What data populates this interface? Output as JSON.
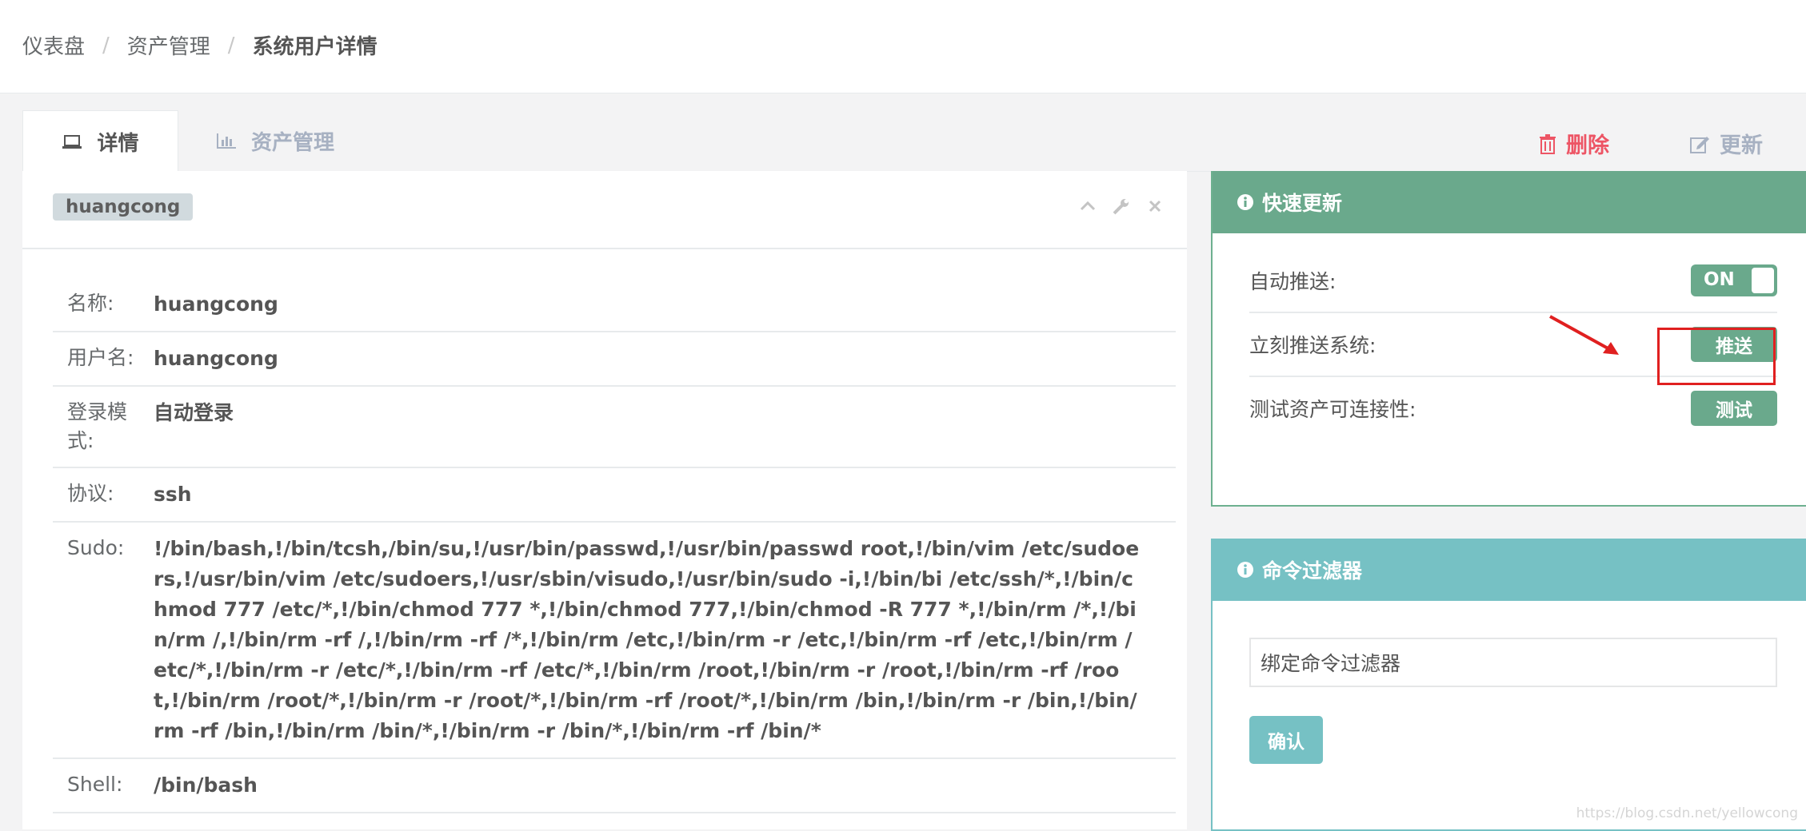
{
  "breadcrumb": [
    "仪表盘",
    "资产管理",
    "系统用户详情"
  ],
  "tabs": {
    "detail": "详情",
    "asset_management": "资产管理"
  },
  "actions": {
    "delete": "删除",
    "update": "更新"
  },
  "detail_panel": {
    "tag": "huangcong",
    "rows": [
      {
        "key": "名称:",
        "value": "huangcong"
      },
      {
        "key": "用户名:",
        "value": "huangcong"
      },
      {
        "key": "登录模式:",
        "value": "自动登录"
      },
      {
        "key": "协议:",
        "value": "ssh"
      },
      {
        "key": "Sudo:",
        "value": "!/bin/bash,!/bin/tcsh,/bin/su,!/usr/bin/passwd,!/usr/bin/passwd root,!/bin/vim /etc/sudoers,!/usr/bin/vim /etc/sudoers,!/usr/sbin/visudo,!/usr/bin/sudo -i,!/bin/bi /etc/ssh/*,!/bin/chmod 777 /etc/*,!/bin/chmod 777 *,!/bin/chmod 777,!/bin/chmod -R 777 *,!/bin/rm /*,!/bin/rm /,!/bin/rm -rf /,!/bin/rm -rf /*,!/bin/rm /etc,!/bin/rm -r /etc,!/bin/rm -rf /etc,!/bin/rm /etc/*,!/bin/rm -r /etc/*,!/bin/rm -rf /etc/*,!/bin/rm /root,!/bin/rm -r /root,!/bin/rm -rf /root,!/bin/rm /root/*,!/bin/rm -r /root/*,!/bin/rm -rf /root/*,!/bin/rm /bin,!/bin/rm -r /bin,!/bin/rm -rf /bin,!/bin/rm /bin/*,!/bin/rm -r /bin/*,!/bin/rm -rf /bin/*"
      },
      {
        "key": "Shell:",
        "value": "/bin/bash"
      }
    ]
  },
  "quick_update": {
    "title": "快速更新",
    "auto_push_label": "自动推送:",
    "auto_push_state": "ON",
    "push_now_label": "立刻推送系统:",
    "push_button": "推送",
    "test_label": "测试资产可连接性:",
    "test_button": "测试"
  },
  "command_filter": {
    "title": "命令过滤器",
    "placeholder": "绑定命令过滤器",
    "confirm_button": "确认"
  },
  "watermark": "https://blog.csdn.net/yellowcong",
  "colors": {
    "green": "#6aa98c",
    "teal": "#76c1c4",
    "danger": "#ed5565",
    "highlight": "#e02020"
  }
}
